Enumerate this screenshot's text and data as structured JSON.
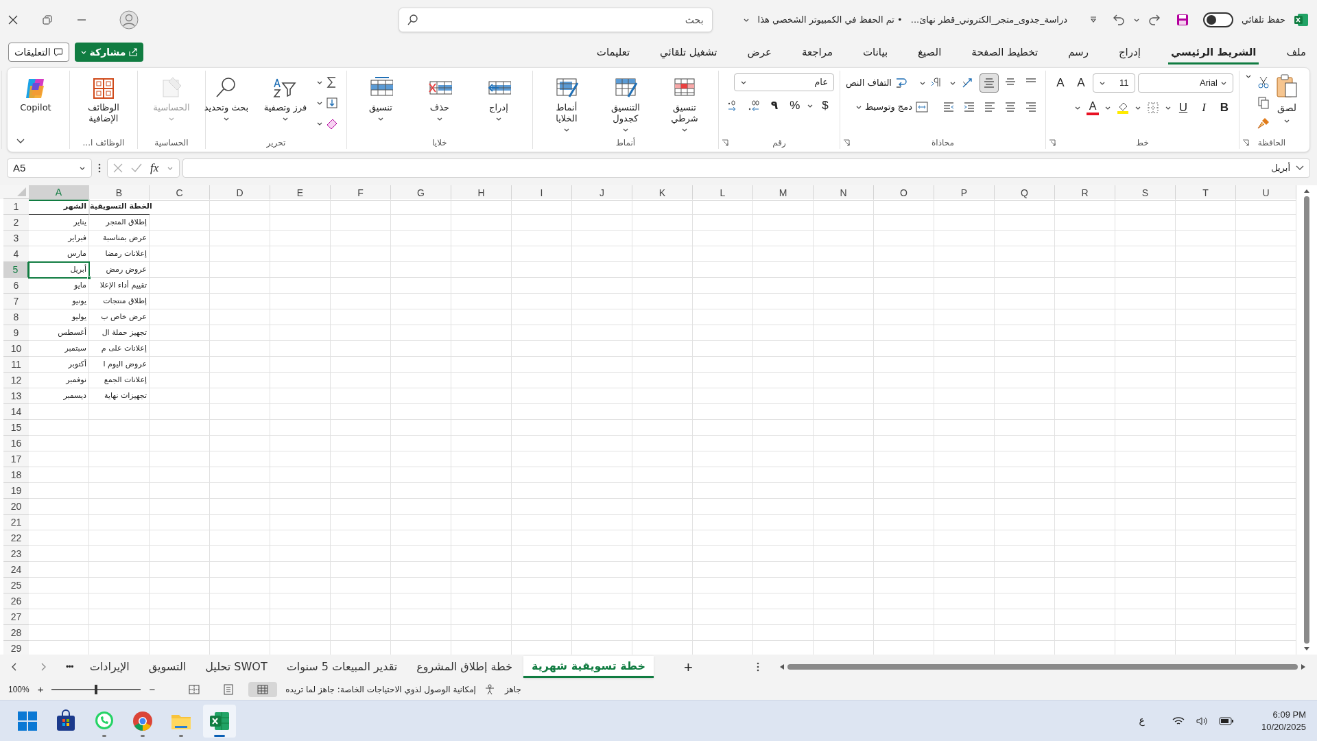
{
  "title_bar": {
    "autosave_label": "حفظ تلقائي",
    "autosave_on": false,
    "document_title": "دراسة_جدوى_متجر_الكتروني_قطر نهائ...",
    "save_status": "• تم الحفظ في الكمبيوتر الشخصي هذا",
    "search_placeholder": "بحث"
  },
  "ribbon_tabs": [
    {
      "label": "ملف",
      "selected": false
    },
    {
      "label": "الشريط الرئيسي",
      "selected": true
    },
    {
      "label": "إدراج",
      "selected": false
    },
    {
      "label": "رسم",
      "selected": false
    },
    {
      "label": "تخطيط الصفحة",
      "selected": false
    },
    {
      "label": "الصيغ",
      "selected": false
    },
    {
      "label": "بيانات",
      "selected": false
    },
    {
      "label": "مراجعة",
      "selected": false
    },
    {
      "label": "عرض",
      "selected": false
    },
    {
      "label": "تشغيل تلقائي",
      "selected": false
    },
    {
      "label": "تعليمات",
      "selected": false
    }
  ],
  "comments_button": "التعليقات",
  "share_button": "مشاركة",
  "ribbon_groups": [
    {
      "kind": "clipboard",
      "label": "الحافظة",
      "paste": "لصق"
    },
    {
      "kind": "font",
      "label": "خط",
      "font_name": "Arial",
      "font_size": "11",
      "grow": "A",
      "shrink": "A",
      "font_color": "A",
      "bold": "B",
      "italic": "I",
      "underline": "U"
    },
    {
      "kind": "alignment",
      "label": "محاذاة",
      "wrap_text": "التفاف النص",
      "merge": "دمج وتوسيط"
    },
    {
      "kind": "number",
      "label": "رقم",
      "format": "عام",
      "currency": "$",
      "percent": "%",
      "comma": "٩"
    },
    {
      "kind": "styles",
      "label": "أنماط",
      "buttons": [
        {
          "label": "تنسيق شرطي",
          "disabled": false
        },
        {
          "label": "التنسيق كجدول",
          "disabled": false
        },
        {
          "label": "أنماط الخلايا",
          "disabled": false
        }
      ]
    },
    {
      "kind": "cells",
      "label": "خلايا",
      "buttons": [
        {
          "label": "إدراج",
          "disabled": false
        },
        {
          "label": "حذف",
          "disabled": false
        },
        {
          "label": "تنسيق",
          "disabled": false
        }
      ]
    },
    {
      "kind": "editing",
      "label": "تحرير",
      "buttons": [
        {
          "label": "فرز وتصفية",
          "disabled": false
        },
        {
          "label": "بحث وتحديد",
          "disabled": false
        }
      ]
    },
    {
      "kind": "sensitivity",
      "label": "الحساسية",
      "buttons": [
        {
          "label": "الحساسية",
          "disabled": true
        }
      ]
    },
    {
      "kind": "addins",
      "label": "الوظائف ا...",
      "buttons": [
        {
          "label": "الوظائف الإضافية",
          "disabled": false
        }
      ]
    },
    {
      "kind": "copilot",
      "buttons": [
        {
          "label": "Copilot",
          "disabled": false
        }
      ]
    }
  ],
  "formula_bar": {
    "name_box": "A5",
    "fx": "fx",
    "formula": "أبريل"
  },
  "grid": {
    "columns": [
      "U",
      "T",
      "S",
      "R",
      "Q",
      "P",
      "O",
      "N",
      "M",
      "L",
      "K",
      "J",
      "I",
      "H",
      "G",
      "F",
      "E",
      "D",
      "C",
      "B",
      "A"
    ],
    "rows": [
      {
        "number": "1",
        "kind": "header",
        "selected": false,
        "cells": [
          "الخطة التسويقية",
          "الشهر"
        ]
      },
      {
        "number": "2",
        "kind": "data",
        "selected": false,
        "cells": [
          "إطلاق المتجر",
          "يناير"
        ]
      },
      {
        "number": "3",
        "kind": "data",
        "selected": false,
        "cells": [
          "عرض بمناسبة",
          "فبراير"
        ]
      },
      {
        "number": "4",
        "kind": "data",
        "selected": false,
        "cells": [
          "إعلانات رمضا",
          "مارس"
        ]
      },
      {
        "number": "5",
        "kind": "data",
        "selected": true,
        "cells": [
          "عروض رمض",
          "أبريل"
        ]
      },
      {
        "number": "6",
        "kind": "data",
        "selected": false,
        "cells": [
          "تقييم أداء الإعلا",
          "مايو"
        ]
      },
      {
        "number": "7",
        "kind": "data",
        "selected": false,
        "cells": [
          "إطلاق منتجات",
          "يونيو"
        ]
      },
      {
        "number": "8",
        "kind": "data",
        "selected": false,
        "cells": [
          "عرض خاص ب",
          "يوليو"
        ]
      },
      {
        "number": "9",
        "kind": "data",
        "selected": false,
        "cells": [
          "تجهيز حملة ال",
          "أغسطس"
        ]
      },
      {
        "number": "10",
        "kind": "data",
        "selected": false,
        "cells": [
          "إعلانات على م",
          "سبتمبر"
        ]
      },
      {
        "number": "11",
        "kind": "data",
        "selected": false,
        "cells": [
          "عروض اليوم ا",
          "أكتوبر"
        ]
      },
      {
        "number": "12",
        "kind": "data",
        "selected": false,
        "cells": [
          "إعلانات الجمع",
          "نوفمبر"
        ]
      },
      {
        "number": "13",
        "kind": "data",
        "selected": false,
        "cells": [
          "تجهيزات نهاية",
          "ديسمبر"
        ]
      },
      {
        "number": "14",
        "kind": "empty",
        "selected": false
      },
      {
        "number": "15",
        "kind": "empty",
        "selected": false
      },
      {
        "number": "16",
        "kind": "empty",
        "selected": false
      },
      {
        "number": "17",
        "kind": "empty",
        "selected": false
      },
      {
        "number": "18",
        "kind": "empty",
        "selected": false
      },
      {
        "number": "19",
        "kind": "empty",
        "selected": false
      },
      {
        "number": "20",
        "kind": "empty",
        "selected": false
      },
      {
        "number": "21",
        "kind": "empty",
        "selected": false
      },
      {
        "number": "22",
        "kind": "empty",
        "selected": false
      },
      {
        "number": "23",
        "kind": "empty",
        "selected": false
      },
      {
        "number": "24",
        "kind": "empty",
        "selected": false
      },
      {
        "number": "25",
        "kind": "empty",
        "selected": false
      },
      {
        "number": "26",
        "kind": "empty",
        "selected": false
      },
      {
        "number": "27",
        "kind": "empty",
        "selected": false
      },
      {
        "number": "28",
        "kind": "empty",
        "selected": false
      },
      {
        "number": "29",
        "kind": "empty",
        "selected": false
      }
    ]
  },
  "sheet_tabs": [
    {
      "label": "خطة تسويقية شهرية",
      "selected": true
    },
    {
      "label": "خطة إطلاق المشروع",
      "selected": false
    },
    {
      "label": "تقدير المبيعات 5 سنوات",
      "selected": false
    },
    {
      "label": "SWOT تحليل",
      "selected": false
    },
    {
      "label": "التسويق",
      "selected": false
    },
    {
      "label": "الإيرادات",
      "selected": false
    }
  ],
  "sheet_nav": {
    "more": "•••",
    "add": "+"
  },
  "status_bar": {
    "ready": "جاهز",
    "accessibility": "إمكانية الوصول لذوي الاحتياجات الخاصة: جاهز لما تريده",
    "zoom": "100%",
    "zoom_slider": {
      "level": 0.5
    },
    "zoom_in": "+",
    "zoom_out": "−",
    "views": [
      {
        "kind": "page_break",
        "selected": false
      },
      {
        "kind": "page_layout",
        "selected": false
      },
      {
        "kind": "normal",
        "selected": true
      }
    ]
  },
  "taskbar": {
    "apps": [
      {
        "kind": "start",
        "running": false,
        "selected": false
      },
      {
        "kind": "store",
        "running": false,
        "selected": false
      },
      {
        "kind": "whatsapp",
        "running": true,
        "selected": false
      },
      {
        "kind": "chrome",
        "running": true,
        "selected": false
      },
      {
        "kind": "explorer",
        "running": true,
        "selected": false
      },
      {
        "kind": "excel",
        "running": true,
        "selected": true
      }
    ],
    "language": "ع",
    "time": "6:09 PM",
    "date": "10/20/2025"
  }
}
